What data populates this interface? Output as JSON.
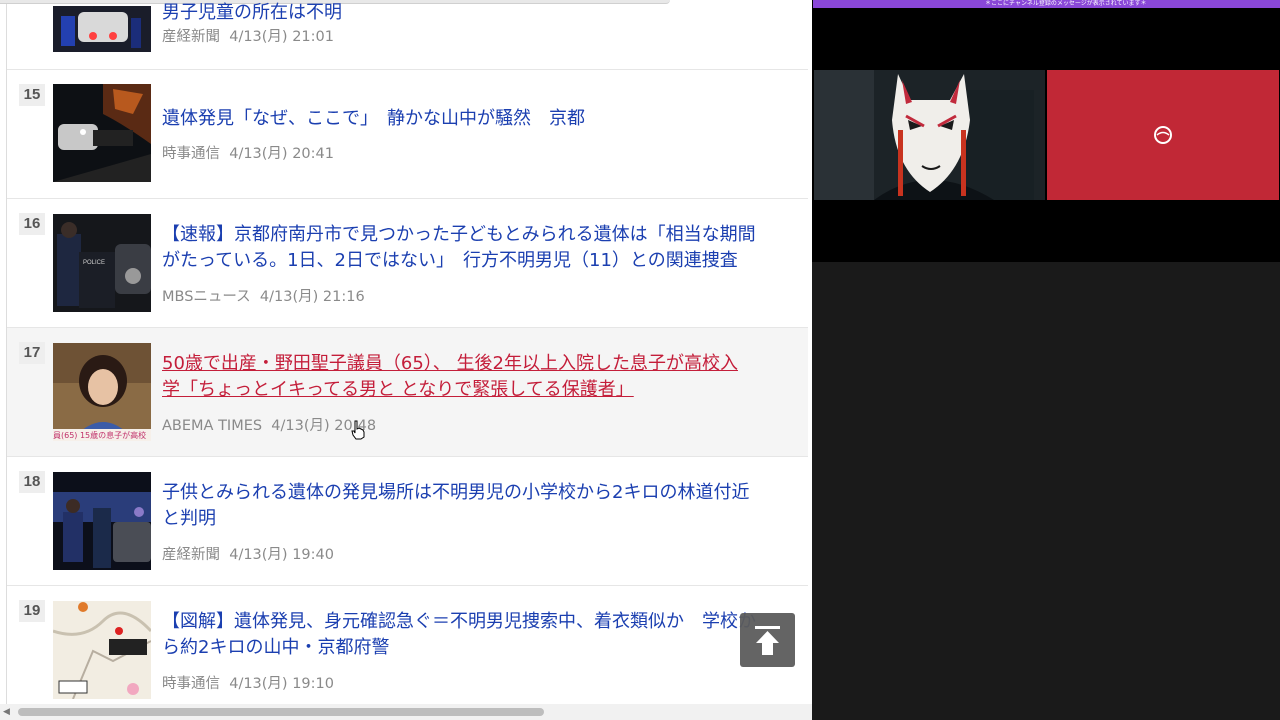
{
  "news": {
    "items": [
      {
        "rank": "",
        "title_lines": [
          "男子児童の所在は不明"
        ],
        "source": "産経新聞",
        "time": "4/13(月) 21:01"
      },
      {
        "rank": "15",
        "title_lines": [
          "遺体発見「なぜ、ここで」　静かな山中が騒然　京都"
        ],
        "source": "時事通信",
        "time": "4/13(月) 20:41"
      },
      {
        "rank": "16",
        "title_lines": [
          "【速報】京都府南丹市で見つかった子どもとみられる遺体は「相当な期間",
          "がたっている。1日、2日ではない」　行方不明男児（11）との関連捜査"
        ],
        "source": "MBSニュース",
        "time": "4/13(月) 21:16"
      },
      {
        "rank": "17",
        "title_lines": [
          "50歳で出産・野田聖子議員（65）、 生後2年以上入院した息子が高校入",
          "学「ちょっとイキってる男と となりで緊張してる保護者」"
        ],
        "source": "ABEMA TIMES",
        "time": "4/13(月) 20:48",
        "thumb_caption": "員(65) 15歳の息子が高校"
      },
      {
        "rank": "18",
        "title_lines": [
          "子供とみられる遺体の発見場所は不明男児の小学校から2キロの林道付近",
          "と判明"
        ],
        "source": "産経新聞",
        "time": "4/13(月) 19:40"
      },
      {
        "rank": "19",
        "title_lines": [
          "【図解】遺体発見、身元確認急ぐ＝不明男児捜索中、着衣類似か　学校か",
          "ら約2キロの山中・京都府警"
        ],
        "source": "時事通信",
        "time": "4/13(月) 19:10"
      }
    ],
    "back_to_top_icon": "arrow-up-icon"
  },
  "stream": {
    "banner_text": "＊ここにチャンネル登録のメッセージが表示されています＊"
  },
  "colors": {
    "link": "#1b3fb0",
    "link_hover": "#c41e3a",
    "meta": "#8a8a8a",
    "banner": "#8a47d8",
    "video_right": "#c12836"
  }
}
